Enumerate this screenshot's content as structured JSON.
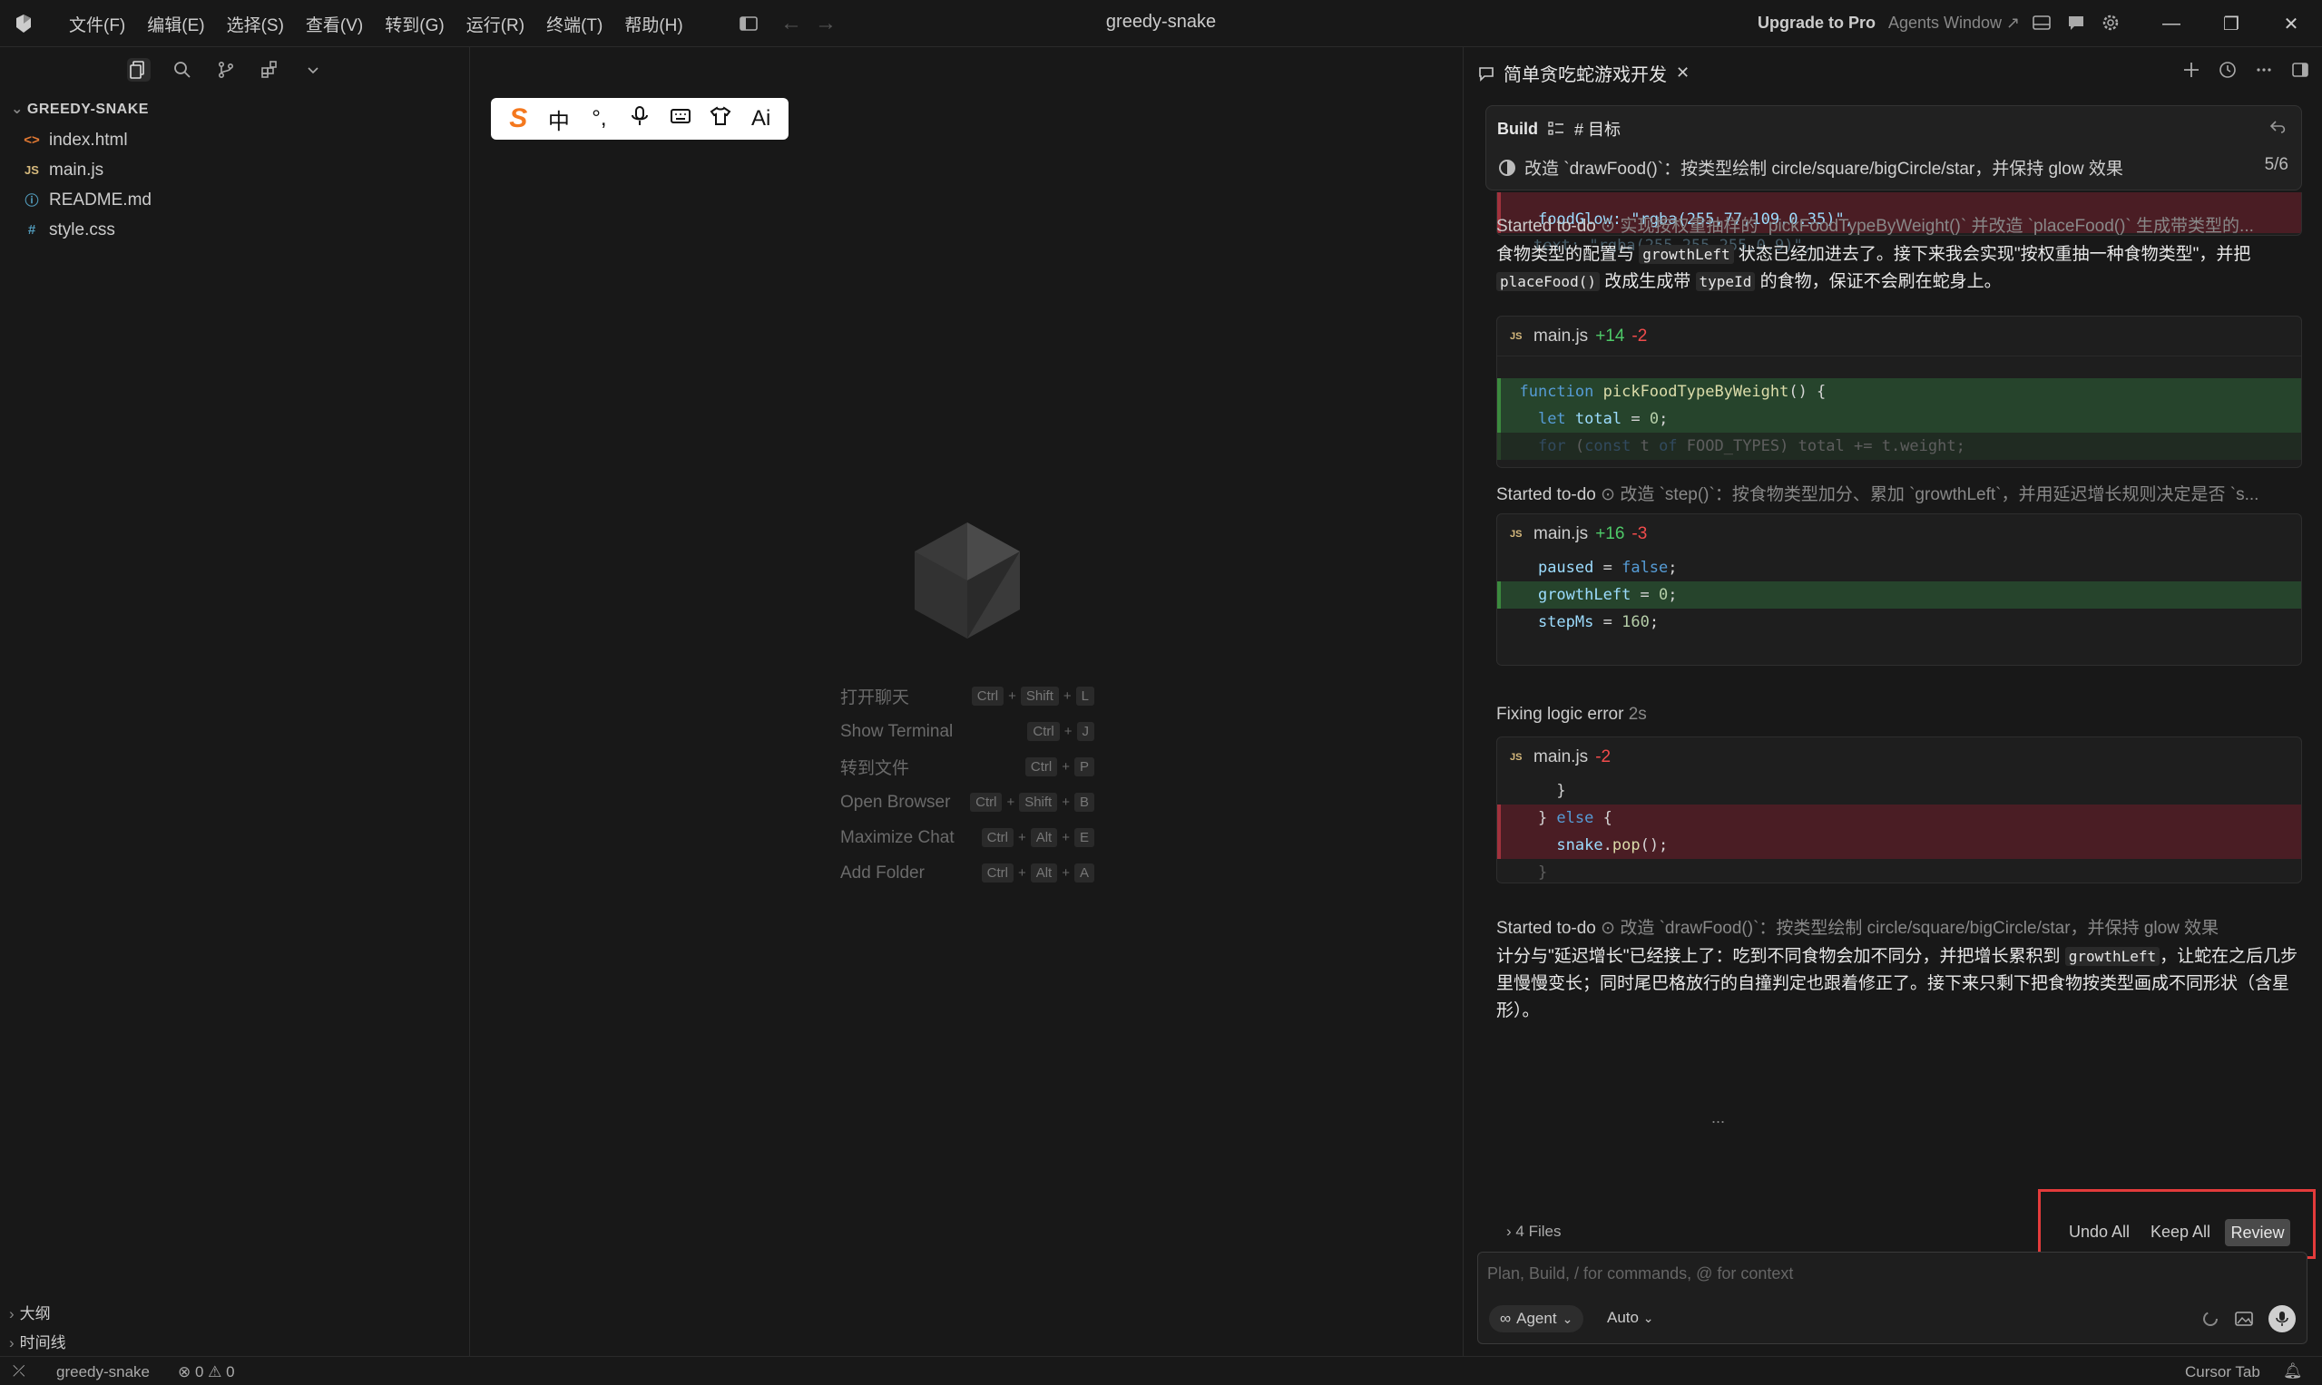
{
  "titlebar": {
    "window_title": "greedy-snake",
    "menu": [
      "文件(F)",
      "编辑(E)",
      "选择(S)",
      "查看(V)",
      "转到(G)",
      "运行(R)",
      "终端(T)",
      "帮助(H)"
    ],
    "upgrade": "Upgrade to Pro",
    "agents_window": "Agents Window ↗"
  },
  "explorer": {
    "title": "GREEDY-SNAKE",
    "files": [
      {
        "name": "index.html",
        "icon": "<>",
        "color": "#e37933"
      },
      {
        "name": "main.js",
        "icon": "JS",
        "color": "#d7ba7d"
      },
      {
        "name": "README.md",
        "icon": "ⓘ",
        "color": "#519aba"
      },
      {
        "name": "style.css",
        "icon": "#",
        "color": "#519aba"
      }
    ],
    "outline": "大纲",
    "timeline": "时间线"
  },
  "ime_toolbar": [
    "S",
    "中",
    "°,",
    "🎙",
    "⌨",
    "👕",
    "Ai"
  ],
  "shortcuts": [
    {
      "label": "打开聊天",
      "keys": [
        "Ctrl",
        "Shift",
        "L"
      ]
    },
    {
      "label": "Show Terminal",
      "keys": [
        "Ctrl",
        "J"
      ]
    },
    {
      "label": "转到文件",
      "keys": [
        "Ctrl",
        "P"
      ]
    },
    {
      "label": "Open Browser",
      "keys": [
        "Ctrl",
        "Shift",
        "B"
      ]
    },
    {
      "label": "Maximize Chat",
      "keys": [
        "Ctrl",
        "Alt",
        "E"
      ]
    },
    {
      "label": "Add Folder",
      "keys": [
        "Ctrl",
        "Alt",
        "A"
      ]
    }
  ],
  "chat": {
    "tab_title": "简单贪吃蛇游戏开发",
    "build_label": "Build",
    "goal_label": "# 目标",
    "current_todo": "改造 `drawFood()`：按类型绘制 circle/square/bigCircle/star，并保持 glow 效果",
    "todo_counter": "5/6",
    "top_code": {
      "line1": "foodGlow: \"rgba(255,77,109,0.35)\",",
      "line2": "text: \"rgba(255,255,255,0.9)\","
    },
    "status1": {
      "prefix": "Started to-do",
      "text": "实现按权重抽样的 `pickFoodTypeByWeight()` 并改造 `placeFood()` 生成带类型的..."
    },
    "para1": {
      "a": "食物类型的配置与 ",
      "code1": "growthLeft",
      "b": " 状态已经加进去了。接下来我会实现\"按权重抽一种食物类型\"，并把 ",
      "code2": "placeFood()",
      "c": " 改成生成带 ",
      "code3": "typeId",
      "d": " 的食物，保证不会刷在蛇身上。"
    },
    "card1": {
      "file": "main.js",
      "added": "+14",
      "removed": "-2"
    },
    "status2": {
      "prefix": "Started to-do",
      "text": "改造 `step()`：按食物类型加分、累加 `growthLeft`，并用延迟增长规则决定是否 `s..."
    },
    "card2": {
      "file": "main.js",
      "added": "+16",
      "removed": "-3"
    },
    "fixing": {
      "text": "Fixing logic error",
      "time": "2s"
    },
    "card3": {
      "file": "main.js",
      "removed": "-2"
    },
    "status3": {
      "prefix": "Started to-do",
      "text": "改造 `drawFood()`：按类型绘制 circle/square/bigCircle/star，并保持 glow 效果"
    },
    "para2": {
      "a": "计分与\"延迟增长\"已经接上了：吃到不同食物会加不同分，并把增长累积到 ",
      "code1": "growthLeft",
      "b": "，让蛇在之后几步里慢慢变长；同时尾巴格放行的自撞判定也跟着修正了。接下来只剩下把食物按类型画成不同形状（含星形）。"
    },
    "more": "...",
    "files_summary": "4 Files",
    "undo_all": "Undo All",
    "keep_all": "Keep All",
    "review": "Review",
    "input_placeholder": "Plan, Build, / for commands, @ for context",
    "agent_mode": "Agent",
    "model": "Auto"
  },
  "statusbar": {
    "branch": "greedy-snake",
    "problems": "⊗ 0 ⚠ 0",
    "cursor_tab": "Cursor Tab"
  }
}
